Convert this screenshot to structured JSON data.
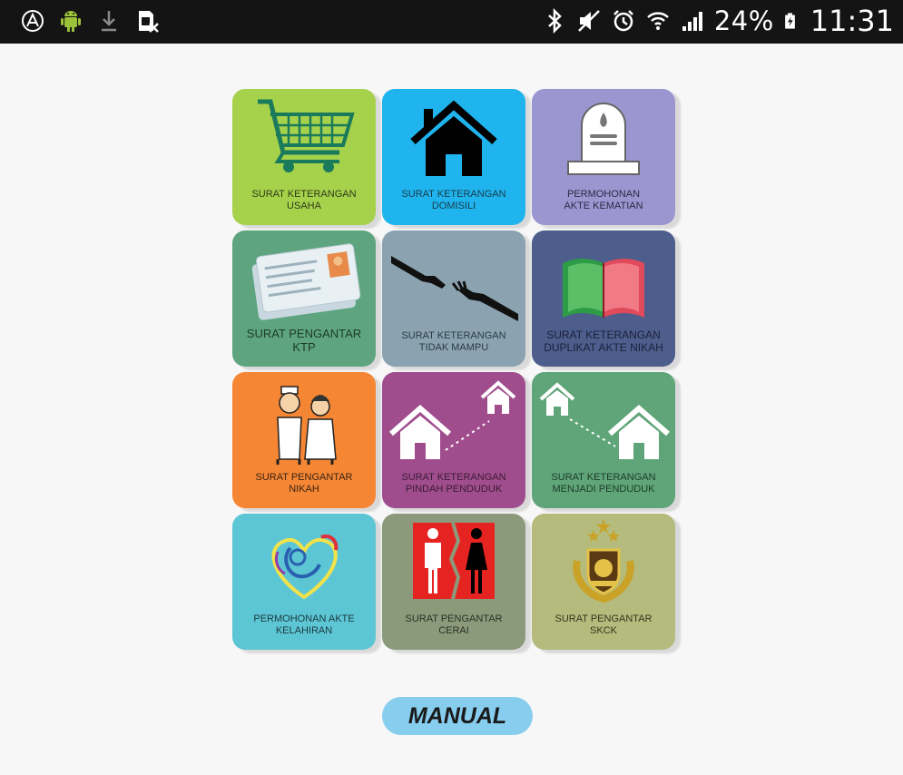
{
  "status_bar": {
    "battery": "24%",
    "time": "11:31",
    "left_icons": [
      "assistant-icon",
      "android-icon",
      "download-icon",
      "sim-icon"
    ],
    "right_icons": [
      "bluetooth-icon",
      "mute-icon",
      "alarm-icon",
      "wifi-icon",
      "signal-icon",
      "battery-icon"
    ]
  },
  "tiles": [
    {
      "id": "usaha",
      "label_l1": "SURAT KETERANGAN",
      "label_l2": "USAHA",
      "color": "#a6d14a",
      "text_color": "#2d3b1a",
      "icon": "shopping-cart-icon"
    },
    {
      "id": "domisili",
      "label_l1": "SURAT KETERANGAN",
      "label_l2": "DOMISILI",
      "color": "#1fb4ee",
      "text_color": "#1a3b4a",
      "icon": "house-icon"
    },
    {
      "id": "kematian",
      "label_l1": "PERMOHONAN",
      "label_l2": "AKTE KEMATIAN",
      "color": "#9c96d0",
      "text_color": "#2a2a44",
      "icon": "gravestone-icon"
    },
    {
      "id": "ktp",
      "label_l1": "SURAT PENGANTAR",
      "label_l2": "KTP",
      "color": "#5ea57f",
      "text_color": "#1e3b2b",
      "icon": "id-card-icon"
    },
    {
      "id": "tidak-mampu",
      "label_l1": "SURAT KETERANGAN",
      "label_l2": "TIDAK MAMPU",
      "color": "#8ba3b0",
      "text_color": "#2a3a44",
      "icon": "reaching-hands-icon"
    },
    {
      "id": "duplikat",
      "label_l1": "SURAT KETERANGAN",
      "label_l2": "DUPLIKAT AKTE NIKAH",
      "color": "#4d5d8c",
      "text_color": "#1a213a",
      "icon": "open-book-icon"
    },
    {
      "id": "nikah",
      "label_l1": "SURAT PENGANTAR",
      "label_l2": "NIKAH",
      "color": "#f58634",
      "text_color": "#3b2414",
      "icon": "couple-icon"
    },
    {
      "id": "pindah",
      "label_l1": "SURAT KETERANGAN",
      "label_l2": "PINDAH PENDUDUK",
      "color": "#a04d8d",
      "text_color": "#3a1b33",
      "icon": "move-house-icon"
    },
    {
      "id": "menjadi",
      "label_l1": "SURAT KETERANGAN",
      "label_l2": "MENJADI PENDUDUK",
      "color": "#5fa579",
      "text_color": "#1e3b29",
      "icon": "move-house-in-icon"
    },
    {
      "id": "kelahiran",
      "label_l1": "PERMOHONAN AKTE",
      "label_l2": "KELAHIRAN",
      "color": "#5dc6d4",
      "text_color": "#1a3a40",
      "icon": "mother-child-icon"
    },
    {
      "id": "cerai",
      "label_l1": "SURAT PENGANTAR",
      "label_l2": "CERAI",
      "color": "#8c9a7c",
      "text_color": "#2a3024",
      "icon": "divorce-icon"
    },
    {
      "id": "skck",
      "label_l1": "SURAT PENGANTAR",
      "label_l2": "SKCK",
      "color": "#b4bb7c",
      "text_color": "#33361d",
      "icon": "police-emblem-icon"
    }
  ],
  "manual_button": {
    "label": "MANUAL",
    "color": "#87cdee"
  }
}
